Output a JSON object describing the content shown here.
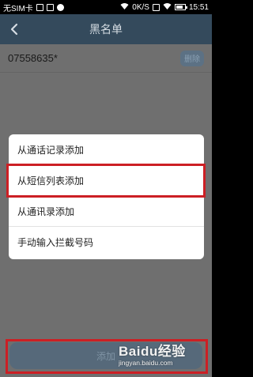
{
  "status_bar": {
    "carrier": "无SIM卡",
    "speed": "0K/S",
    "time": "15:51",
    "battery_level": 0.75
  },
  "title_bar": {
    "title": "黑名单"
  },
  "blacklist": {
    "entries": [
      {
        "number": "07558635*",
        "delete_label": "删除"
      }
    ]
  },
  "dialog": {
    "options": [
      "从通话记录添加",
      "从短信列表添加",
      "从通讯录添加",
      "手动输入拦截号码"
    ]
  },
  "add_button": {
    "label": "添加"
  },
  "watermark": {
    "logo": "Baidu经验",
    "url": "jingyan.baidu.com"
  },
  "colors": {
    "title_bar": "#344a5c",
    "overlay": "#6f6f6f",
    "highlight": "#cc1f24",
    "button": "#56697a"
  }
}
